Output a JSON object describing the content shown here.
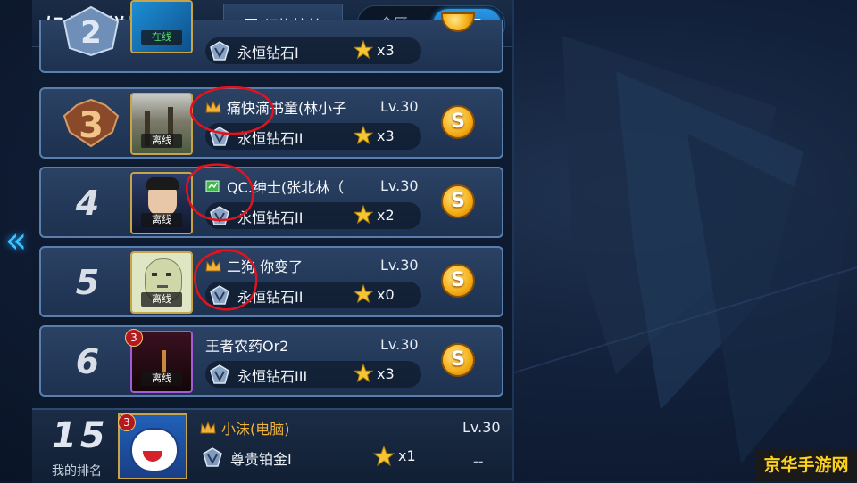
{
  "header": {
    "title": "好友天梯排行",
    "switch_label": "切换榜单",
    "tabs": [
      {
        "label": "全区",
        "active": false
      },
      {
        "label": "好友",
        "active": true
      }
    ]
  },
  "rows": [
    {
      "rank": "2",
      "status": "在线",
      "name": "",
      "level": "",
      "tier": "永恒钻石I",
      "stars": "x3"
    },
    {
      "rank": "3",
      "status": "离线",
      "name": "痛快滴书童(林小子",
      "level": "Lv.30",
      "tier": "永恒钻石II",
      "stars": "x3"
    },
    {
      "rank": "4",
      "status": "离线",
      "name": "QC.绅士(张北林（",
      "level": "Lv.30",
      "tier": "永恒钻石II",
      "stars": "x2"
    },
    {
      "rank": "5",
      "status": "离线",
      "name": "二狗 你变了",
      "level": "Lv.30",
      "tier": "永恒钻石II",
      "stars": "x0"
    },
    {
      "rank": "6",
      "status": "离线",
      "name": "王者农药Or2",
      "level": "Lv.30",
      "tier": "永恒钻石III",
      "stars": "x3",
      "badge": "3"
    }
  ],
  "my_rank": {
    "rank": "15",
    "label": "我的排名",
    "name": "小沫(电脑)",
    "level": "Lv.30",
    "tier": "尊贵铂金I",
    "stars": "x1",
    "extra": "--",
    "badge": "3"
  },
  "watermark": "京华手游网",
  "colors": {
    "accent": "#2b98e8",
    "row_border": "#5a7fae",
    "marker": "#e0141e",
    "coin": "#f6b21b"
  }
}
